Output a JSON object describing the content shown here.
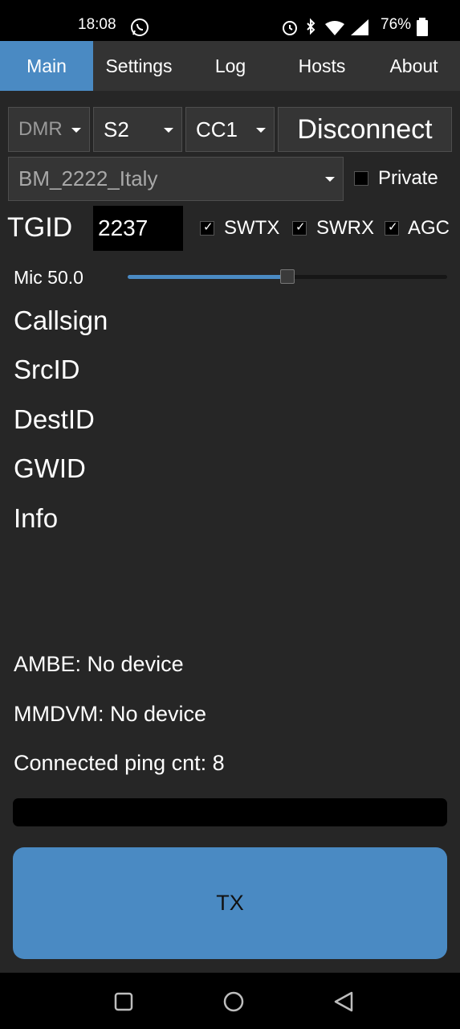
{
  "status_bar": {
    "time": "18:08",
    "battery": "76%",
    "icons": [
      "whatsapp-icon",
      "alarm-icon",
      "bluetooth-icon",
      "wifi-icon",
      "signal-icon",
      "battery-icon"
    ]
  },
  "tabs": [
    {
      "label": "Main",
      "active": true
    },
    {
      "label": "Settings",
      "active": false
    },
    {
      "label": "Log",
      "active": false
    },
    {
      "label": "Hosts",
      "active": false
    },
    {
      "label": "About",
      "active": false
    }
  ],
  "mode_select": {
    "value": "DMR"
  },
  "slot_select": {
    "value": "S2"
  },
  "cc_select": {
    "value": "CC1"
  },
  "connect_button": {
    "label": "Disconnect"
  },
  "host_select": {
    "value": "BM_2222_Italy"
  },
  "private": {
    "label": "Private",
    "checked": false
  },
  "tgid": {
    "label": "TGID",
    "value": "2237"
  },
  "swtx": {
    "label": "SWTX",
    "checked": true
  },
  "swrx": {
    "label": "SWRX",
    "checked": true
  },
  "agc": {
    "label": "AGC",
    "checked": true
  },
  "mic": {
    "label": "Mic 50.0",
    "level": 0.5
  },
  "info_fields": {
    "callsign": "Callsign",
    "srcid": "SrcID",
    "destid": "DestID",
    "gwid": "GWID",
    "info": "Info"
  },
  "status": {
    "ambe": "AMBE: No device",
    "mmdvm": "MMDVM: No device",
    "ping": "Connected ping cnt: 8"
  },
  "tx_button": {
    "label": "TX"
  },
  "nav": {
    "icons": [
      "square-icon",
      "circle-icon",
      "back-triangle-icon"
    ]
  },
  "colors": {
    "accent": "#4a8ac3",
    "background": "#262626",
    "tab_bar": "#333333"
  }
}
